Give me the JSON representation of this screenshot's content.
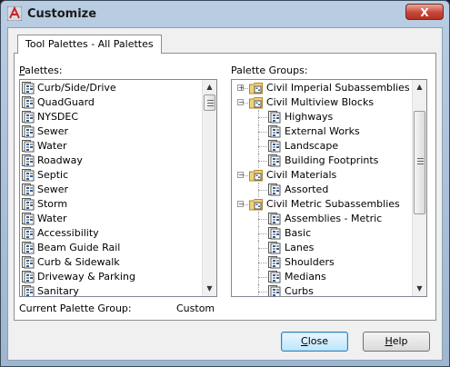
{
  "window": {
    "title": "Customize",
    "close_glyph": "X",
    "app_icon": "autocad-icon"
  },
  "tab": {
    "label": "Tool Palettes - All Palettes"
  },
  "palettes": {
    "label_mnemonic": "P",
    "label_rest": "alettes:",
    "items": [
      "Curb/Side/Drive",
      "QuadGuard",
      "NYSDEC",
      "Sewer",
      "Water",
      "Roadway",
      "Septic",
      "Sewer",
      "Storm",
      "Water",
      "Accessibility",
      "Beam Guide Rail",
      "Curb & Sidewalk",
      "Driveway & Parking",
      "Sanitary"
    ]
  },
  "palette_groups": {
    "label": "Palette Groups:",
    "items": [
      {
        "label": "Civil Imperial Subassemblies",
        "level": 0,
        "toggle": "+"
      },
      {
        "label": "Civil Multiview Blocks",
        "level": 0,
        "toggle": "-"
      },
      {
        "label": "Highways",
        "level": 1
      },
      {
        "label": "External Works",
        "level": 1
      },
      {
        "label": "Landscape",
        "level": 1
      },
      {
        "label": "Building Footprints",
        "level": 1
      },
      {
        "label": "Civil Materials",
        "level": 0,
        "toggle": "-"
      },
      {
        "label": "Assorted",
        "level": 1
      },
      {
        "label": "Civil Metric Subassemblies",
        "level": 0,
        "toggle": "-"
      },
      {
        "label": "Assemblies - Metric",
        "level": 1
      },
      {
        "label": "Basic",
        "level": 1
      },
      {
        "label": "Lanes",
        "level": 1
      },
      {
        "label": "Shoulders",
        "level": 1
      },
      {
        "label": "Medians",
        "level": 1
      },
      {
        "label": "Curbs",
        "level": 1
      }
    ]
  },
  "current_group": {
    "label": "Current Palette Group:",
    "value": "Custom"
  },
  "buttons": {
    "close_mnemonic": "C",
    "close_rest": "lose",
    "help_mnemonic": "H",
    "help_rest": "elp"
  },
  "scroll_glyphs": {
    "up": "▲",
    "down": "▼"
  },
  "colors": {
    "title_gradient_top": "#b9cde3",
    "close_red": "#c7473a",
    "default_button": "#3c7fb1"
  }
}
